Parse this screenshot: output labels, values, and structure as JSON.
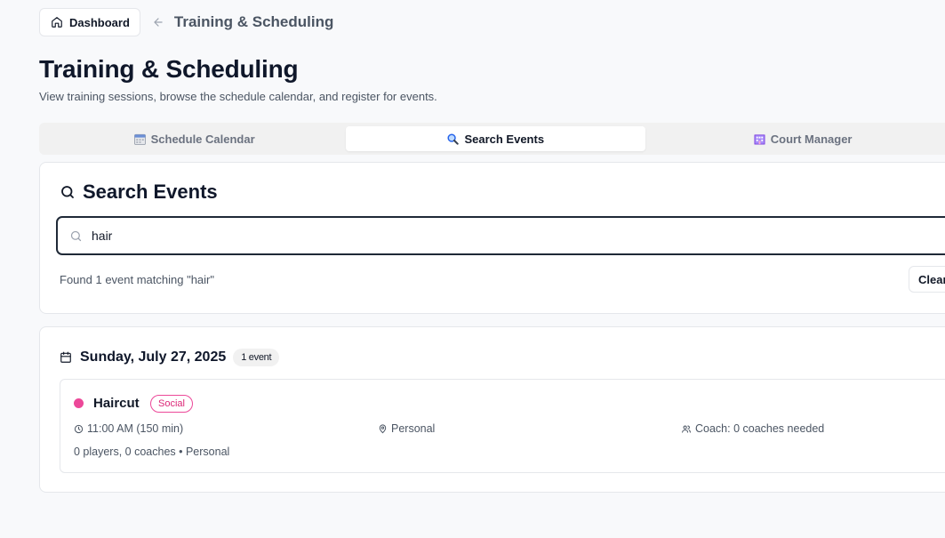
{
  "header": {
    "dashboard_label": "Dashboard",
    "breadcrumb": "Training & Scheduling"
  },
  "page": {
    "title": "Training & Scheduling",
    "subtitle": "View training sessions, browse the schedule calendar, and register for events."
  },
  "tabs": [
    {
      "label": "Schedule Calendar",
      "icon": "calendar-emoji-icon",
      "active": false
    },
    {
      "label": "Search Events",
      "icon": "magnifier-emoji-icon",
      "active": true
    },
    {
      "label": "Court Manager",
      "icon": "building-emoji-icon",
      "active": false
    }
  ],
  "search": {
    "heading": "Search Events",
    "query": "hair",
    "result_text": "Found 1 event matching \"hair\"",
    "clear_label": "Clear"
  },
  "results": {
    "date": "Sunday, July 27, 2025",
    "count_badge": "1 event",
    "events": [
      {
        "title": "Haircut",
        "tag": "Social",
        "time": "11:00 AM (150 min)",
        "location": "Personal",
        "coach": "Coach: 0 coaches needed",
        "footer": "0 players, 0 coaches • Personal"
      }
    ]
  },
  "colors": {
    "event_dot": "#ec4899",
    "tag_border": "#ec4899",
    "search_border": "#1f2937"
  }
}
